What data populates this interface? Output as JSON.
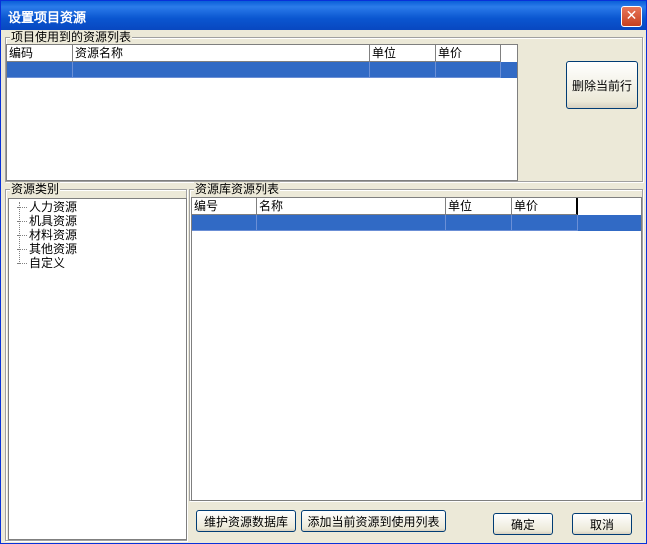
{
  "window": {
    "title": "设置项目资源",
    "close_glyph": "✕"
  },
  "used_group": {
    "label": "项目使用到的资源列表",
    "columns": [
      "编码",
      "资源名称",
      "单位",
      "单价"
    ],
    "delete_button": "删除当前行"
  },
  "category_group": {
    "label": "资源类别",
    "items": [
      "人力资源",
      "机具资源",
      "材料资源",
      "其他资源",
      "自定义"
    ]
  },
  "library_group": {
    "label": "资源库资源列表",
    "columns": [
      "编号",
      "名称",
      "单位",
      "单价"
    ]
  },
  "footer": {
    "maintain_button": "维护资源数据库",
    "add_button": "添加当前资源到使用列表",
    "ok_button": "确定",
    "cancel_button": "取消"
  }
}
